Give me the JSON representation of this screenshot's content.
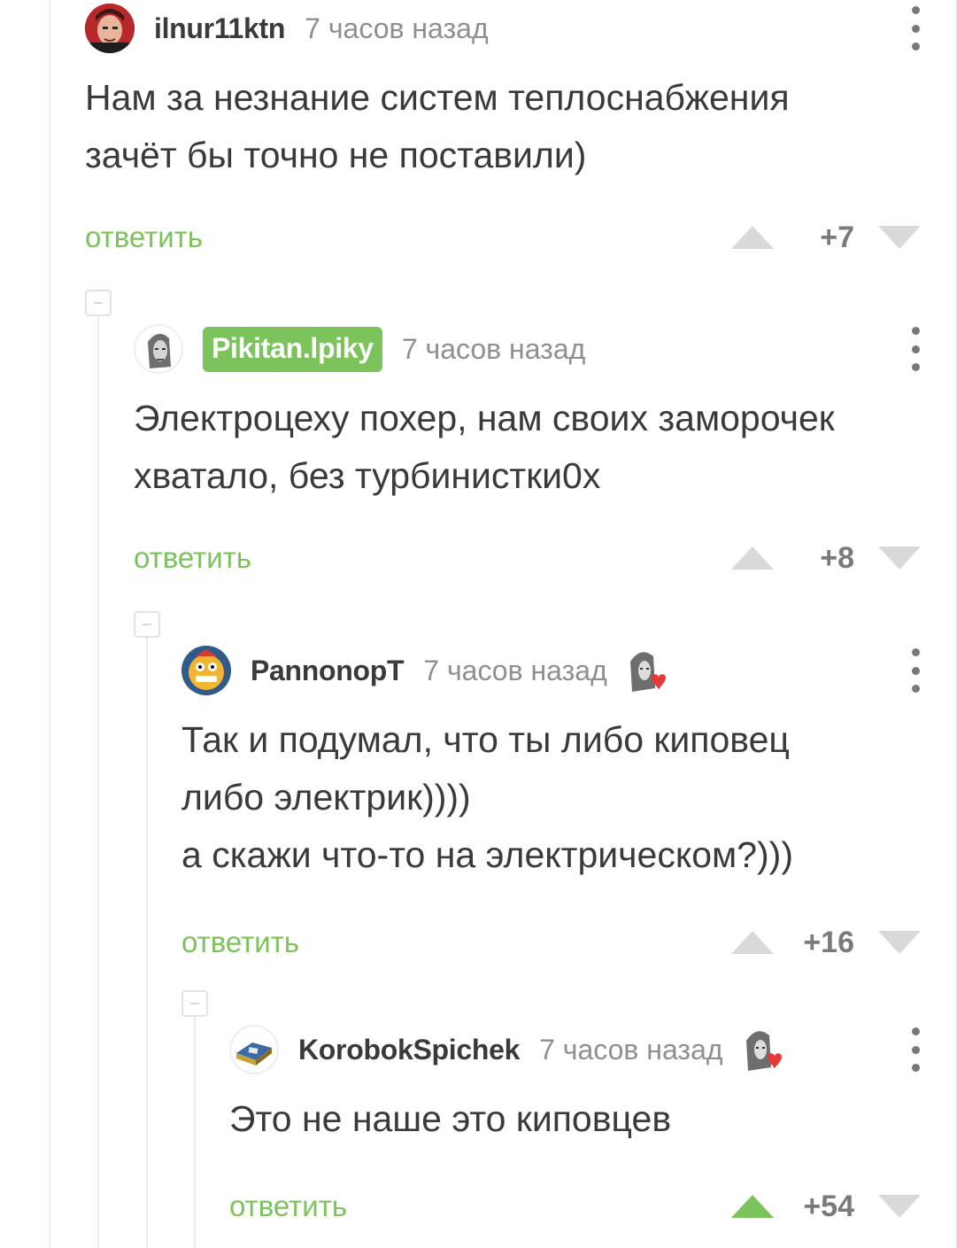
{
  "comments": [
    {
      "username": "ilnur11ktn",
      "time": "7 часов назад",
      "body": "Нам за незнание систем теплоснабжения зачёт бы точно не поставили)",
      "reply_label": "ответить",
      "score": "+7",
      "upvoted": false
    },
    {
      "username": "Pikitan.lpiky",
      "is_author": true,
      "time": "7 часов назад",
      "body": "Электроцеху похер, нам своих заморочек хватало, без турбинистки0х",
      "reply_label": "ответить",
      "score": "+8",
      "upvoted": false
    },
    {
      "username": "PannonopT",
      "time": "7 часов назад",
      "liked_by_author": true,
      "body": "Так и подумал, что ты либо киповец\nлибо электрик))))\nа скажи что-то на электрическом?)))",
      "reply_label": "ответить",
      "score": "+16",
      "upvoted": false
    },
    {
      "username": "KorobokSpichek",
      "time": "7 часов назад",
      "liked_by_author": true,
      "body": "Это не наше это киповцев",
      "reply_label": "ответить",
      "score": "+54",
      "upvoted": true
    }
  ],
  "colors": {
    "accent_green": "#7bc35a",
    "vote_grey": "#d9d9d9",
    "text": "#3a3a3a",
    "meta": "#8f8f8f"
  }
}
